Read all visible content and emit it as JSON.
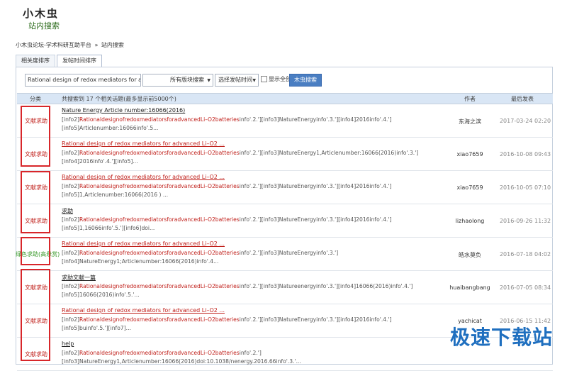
{
  "logo": {
    "title": "小木虫",
    "subtitle": "站内搜索"
  },
  "breadcrumb": {
    "site": "小木虫论坛-学术科研互助平台",
    "separator": "»",
    "current": "站内搜索"
  },
  "tabs": [
    {
      "label": "相关度排序",
      "active": false
    },
    {
      "label": "发帖时间排序",
      "active": true
    }
  ],
  "search": {
    "keyword": "Rational design of redox mediators for adva",
    "section_select": "所有版块搜索",
    "time_select": "选择发帖时间",
    "show_all_label": "显示全部",
    "show_all_checked": false,
    "button_label": "木虫搜索"
  },
  "table": {
    "headers": {
      "category": "分类",
      "summary": "共搜索到 17 个相关话题(最多显示前5000个)",
      "author": "作者",
      "last_post": "最后发表"
    },
    "rows": [
      {
        "category": "文献求助",
        "title": "Nature Energy Article number:16066(2016)",
        "title_red": false,
        "body_prefix": "[info2]",
        "body_hl": "RationaldesignofredoxmediatorsforadvancedLi–O2batteries",
        "body_rest": "info'.2.'][info3]NatureEnergyinfo'.3.'][info4]2016info'.4.'][info5]Articlenumber:16066info'.5...",
        "author": "东海之滨",
        "date": "2017-03-24 02:20"
      },
      {
        "category": "文献求助",
        "title": "Rational design of redox mediators for advanced Li–O2 ...",
        "title_red": true,
        "body_prefix": "[info2]",
        "body_hl": "RationaldesignofredoxmediatorsforadvancedLi–O2batteries",
        "body_rest": "info'.2.'][info3]NatureEnergy1,Articlenumber:16066(2016)info'.3.'][info4]2016info'.4.'][info5]...",
        "author": "xiao7659",
        "date": "2016-10-08 09:43"
      },
      {
        "category": "文献求助",
        "title": "Rational design of redox mediators for advanced Li–O2 ...",
        "title_red": true,
        "body_prefix": "[info2]",
        "body_hl": "RationaldesignofredoxmediatorsforadvancedLi–O2batteries",
        "body_rest": "info'.2.'][info3]NatureEnergyinfo'.3.'][info4]2016info'.4.'][info5]1,Articlenumber:16066(2016 ) ...",
        "author": "xiao7659",
        "date": "2016-10-05 07:10"
      },
      {
        "category": "文献求助",
        "title": "求助",
        "title_red": false,
        "body_prefix": "[info2]",
        "body_hl": "RationaldesignofredoxmediatorsforadvancedLi–O2batteries",
        "body_rest": "info'.2.'][info3]NatureEnergyinfo'.3.'][info4]2016info'.4.'][info5]1,16066info'.5.'][info6]doi...",
        "author": "lizhaolong",
        "date": "2016-09-26 11:32"
      },
      {
        "category": "绿色求助(高悬赏)",
        "title": "Rational design of redox mediators for advanced Li–O2 ...",
        "title_red": true,
        "body_prefix": "[info2]",
        "body_hl": "RationaldesignofredoxmediatorsforadvancedLi–O2batteries",
        "body_rest": "info'.2.'][info3]NatureEnergyinfo'.3.'][info4]NatureEnergy1;Articlenumber:16066(2016)info'.4...",
        "author": "皓水莫负",
        "date": "2016-07-18 04:02"
      },
      {
        "category": "文献求助",
        "title": "求助文献一篇",
        "title_red": false,
        "body_prefix": "[info2]",
        "body_hl": "RationaldesignofredoxmediatorsforadvancedLi–O2batteries",
        "body_rest": "info'.2.'][info3]Natureenergyinfo'.3.'][info4]16066(2016)info'.4.'][info5]16066(2016)info'.5.'...",
        "author": "huaibangbang",
        "date": "2016-07-05 08:34"
      },
      {
        "category": "文献求助",
        "title": "Rational design of redox mediators for advanced Li–O2 ...",
        "title_red": true,
        "body_prefix": "[info2]",
        "body_hl": "RationaldesignofredoxmediatorsforadvancedLi–O2batteries",
        "body_rest": "info'.2.'][info3]NatureEnergyinfo'.3.'][info4]2016info'.4.'][info5]buinfo'.5.'][info7]...",
        "author": "yachicat",
        "date": "2016-06-15 11:42"
      },
      {
        "category": "文献求助",
        "title": "help",
        "title_red": false,
        "body_prefix": "[info2]",
        "body_hl": "RationaldesignofredoxmediatorsforadvancedLi–O2batteries",
        "body_rest": "info'.2.'][info3]NatureEnergy1,Articlenumber:16066(2016)doi:10.1038/nenergy.2016.66info'.3.'...",
        "author": "",
        "date": ""
      }
    ]
  },
  "watermark": "极速下载站",
  "colors": {
    "accent": "#4a7ec2",
    "highlight": "#c0201b",
    "header_bg": "#d9e6f5",
    "annotation_box": "#d8262a"
  }
}
